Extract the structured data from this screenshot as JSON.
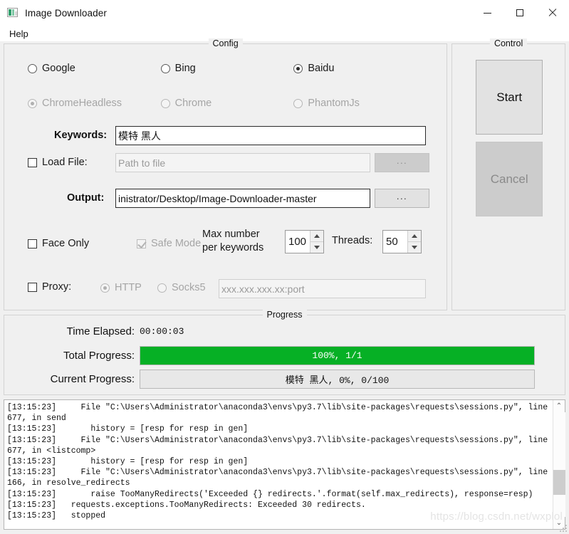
{
  "window": {
    "title": "Image Downloader",
    "icon": "image-icon",
    "minimize": "—",
    "maximize": "□",
    "close": "✕"
  },
  "menu": {
    "items": [
      {
        "label": "Help"
      }
    ]
  },
  "config": {
    "title": "Config",
    "engines": [
      {
        "label": "Google",
        "checked": false,
        "enabled": true
      },
      {
        "label": "Bing",
        "checked": false,
        "enabled": true
      },
      {
        "label": "Baidu",
        "checked": true,
        "enabled": true
      }
    ],
    "drivers": [
      {
        "label": "ChromeHeadless",
        "checked": true,
        "enabled": false
      },
      {
        "label": "Chrome",
        "checked": false,
        "enabled": false
      },
      {
        "label": "PhantomJs",
        "checked": false,
        "enabled": false
      }
    ],
    "keywords": {
      "label": "Keywords:",
      "value": "模特 黑人"
    },
    "load_file": {
      "label": "Load File:",
      "checked": false,
      "placeholder": "Path to file",
      "value": "",
      "browse_label": "..."
    },
    "output": {
      "label": "Output:",
      "value": "inistrator/Desktop/Image-Downloader-master",
      "browse_label": "..."
    },
    "face_only": {
      "label": "Face Only",
      "checked": false,
      "enabled": true
    },
    "safe_mode": {
      "label": "Safe Mode",
      "checked": true,
      "enabled": false
    },
    "max_number": {
      "label_line1": "Max number",
      "label_line2": "per keywords",
      "value": "100"
    },
    "threads": {
      "label": "Threads:",
      "value": "50"
    },
    "proxy": {
      "label": "Proxy:",
      "checked": false,
      "types": [
        {
          "label": "HTTP",
          "checked": true,
          "enabled": false
        },
        {
          "label": "Socks5",
          "checked": false,
          "enabled": false
        }
      ],
      "placeholder": "xxx.xxx.xxx.xx:port",
      "value": ""
    }
  },
  "control": {
    "title": "Control",
    "start_label": "Start",
    "cancel_label": "Cancel",
    "start_enabled": true,
    "cancel_enabled": false
  },
  "progress": {
    "title": "Progress",
    "time_elapsed_label": "Time Elapsed:",
    "time_elapsed_value": "00:00:03",
    "total_label": "Total Progress:",
    "total_text": "100%,  1/1",
    "total_percent": 100,
    "current_label": "Current Progress:",
    "current_text": "模特 黑人,  0%,  0/100",
    "current_percent": 0,
    "bar_color": "#06b025",
    "bar_empty_color": "#e8e8e8"
  },
  "log": {
    "lines": [
      "[13:15:23]     File \"C:\\Users\\Administrator\\anaconda3\\envs\\py3.7\\lib\\site-packages\\requests\\sessions.py\", line 677, in send",
      "[13:15:23]       history = [resp for resp in gen]",
      "[13:15:23]     File \"C:\\Users\\Administrator\\anaconda3\\envs\\py3.7\\lib\\site-packages\\requests\\sessions.py\", line 677, in <listcomp>",
      "[13:15:23]       history = [resp for resp in gen]",
      "[13:15:23]     File \"C:\\Users\\Administrator\\anaconda3\\envs\\py3.7\\lib\\site-packages\\requests\\sessions.py\", line 166, in resolve_redirects",
      "[13:15:23]       raise TooManyRedirects('Exceeded {} redirects.'.format(self.max_redirects), response=resp)",
      "[13:15:23]   requests.exceptions.TooManyRedirects: Exceeded 30 redirects.",
      "[13:15:23]   stopped"
    ],
    "scroll_up": "⌃",
    "scroll_down": "⌄"
  },
  "watermark": "https://blog.csdn.net/wxplol"
}
